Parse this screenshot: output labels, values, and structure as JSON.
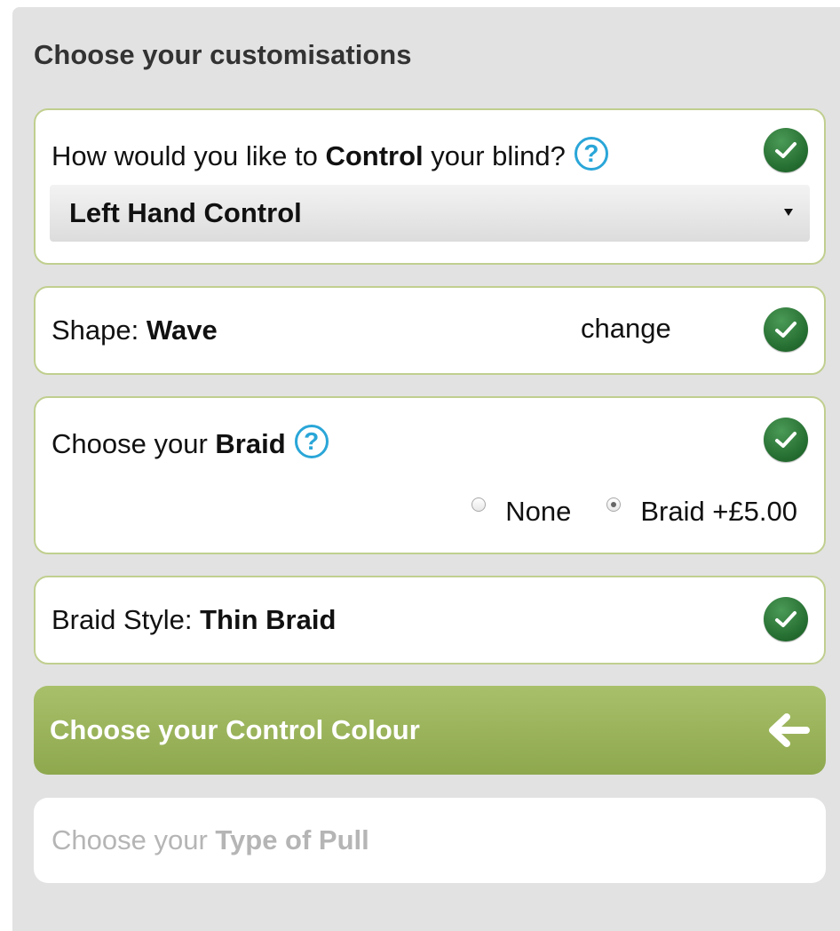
{
  "panel": {
    "title": "Choose your customisations"
  },
  "control": {
    "question_pre": "How would you like to ",
    "question_bold": "Control",
    "question_post": " your blind?",
    "help_icon": "question-circle-icon",
    "selected": "Left Hand Control"
  },
  "shape": {
    "label": "Shape: ",
    "value": "Wave",
    "change_label": "change"
  },
  "braid": {
    "label_pre": "Choose your ",
    "label_bold": "Braid",
    "options": [
      {
        "label": "None",
        "checked": false
      },
      {
        "label": "Braid +£5.00",
        "checked": true
      }
    ]
  },
  "braid_style": {
    "label": "Braid Style: ",
    "value": "Thin Braid"
  },
  "control_colour": {
    "label": "Choose your Control Colour",
    "icon": "arrow-left-icon"
  },
  "pull_type": {
    "label_pre": "Choose your ",
    "label_bold": "Type of Pull"
  },
  "colors": {
    "accent_green": "#9bb55c",
    "check_green": "#236b2f",
    "help_blue": "#2aa6d8"
  }
}
